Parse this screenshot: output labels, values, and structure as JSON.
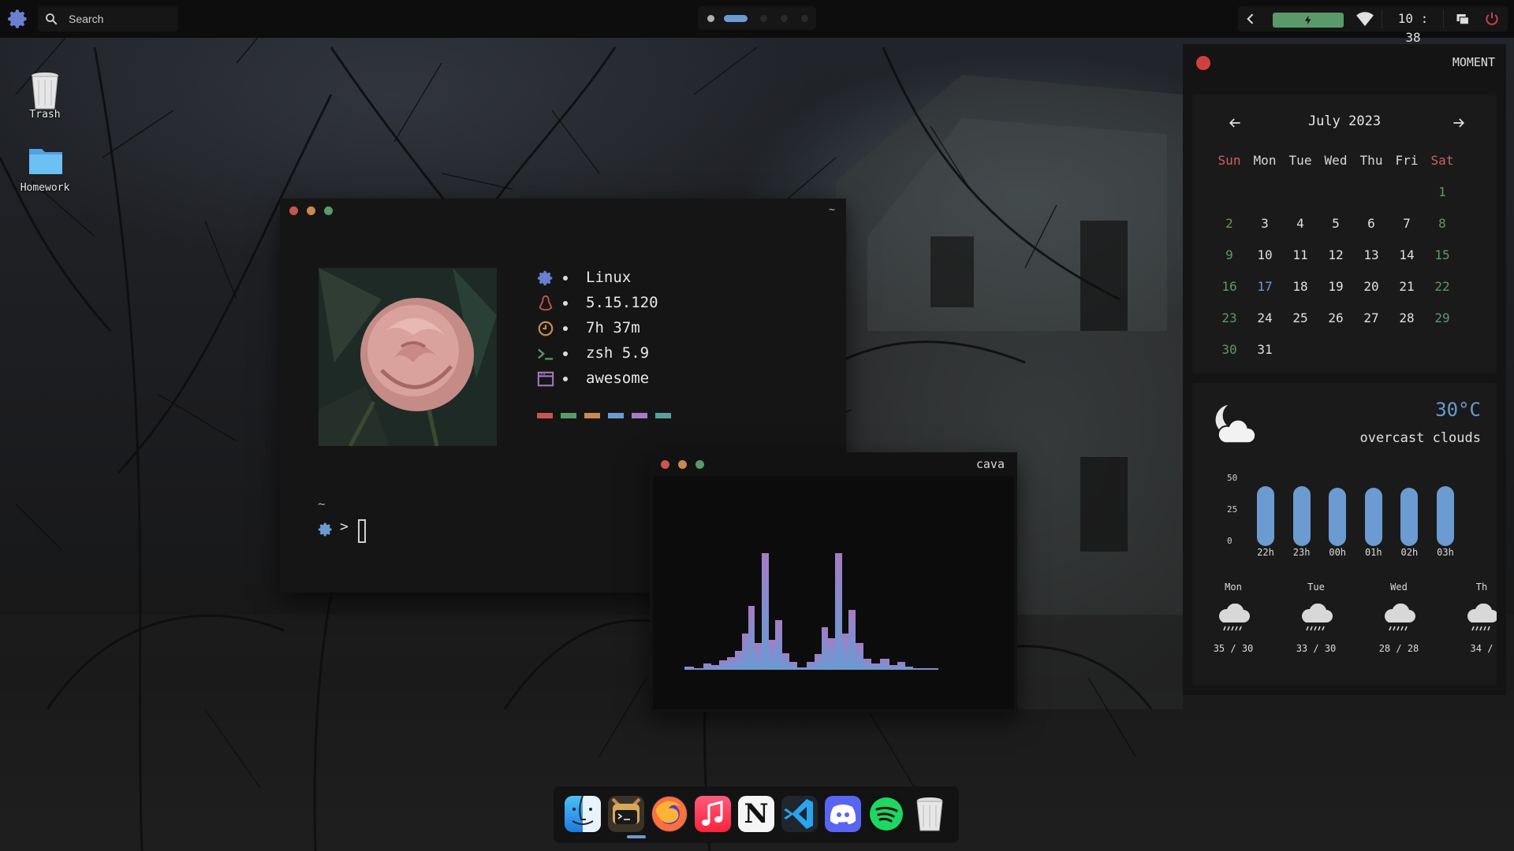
{
  "colors": {
    "accent": "#6b9bd0",
    "green": "#5a9a6a",
    "red": "#d0403f",
    "weekend_head": "#d06060"
  },
  "topbar": {
    "launcher_icon": "gear-icon",
    "search_label": "Search",
    "workspaces": {
      "count": 5,
      "active_index": 1,
      "occupied": [
        0,
        1
      ]
    },
    "clock": "10 : 38"
  },
  "desktop": {
    "icons": [
      {
        "label": "Trash",
        "icon": "trash-icon"
      },
      {
        "label": "Homework",
        "icon": "folder-icon"
      }
    ]
  },
  "terminal": {
    "title": "~",
    "fetch": [
      {
        "icon": "gear-icon",
        "value": "Linux"
      },
      {
        "icon": "tux-icon",
        "value": "5.15.120"
      },
      {
        "icon": "clock-icon",
        "value": "7h 37m"
      },
      {
        "icon": "shell-icon",
        "value": "zsh 5.9"
      },
      {
        "icon": "window-icon",
        "value": "awesome"
      }
    ],
    "palette": [
      "#c9554f",
      "#5a9a6a",
      "#c88a52",
      "#6b9bd0",
      "#a77bc4",
      "#5aa0a0"
    ],
    "prompt_dir": "~",
    "prompt_symbol": ">"
  },
  "cava": {
    "title": "cava"
  },
  "panel": {
    "header": "MOMENT",
    "calendar": {
      "title": "July 2023",
      "weekdays": [
        "Sun",
        "Mon",
        "Tue",
        "Wed",
        "Thu",
        "Fri",
        "Sat"
      ],
      "first_weekday_index": 6,
      "days_in_month": 31,
      "today": 17
    },
    "weather": {
      "temp": "30°C",
      "description": "overcast clouds",
      "axis": [
        "50",
        "25",
        "0"
      ],
      "hourly": [
        {
          "label": "22h",
          "value": 30
        },
        {
          "label": "23h",
          "value": 30
        },
        {
          "label": "00h",
          "value": 29
        },
        {
          "label": "01h",
          "value": 29
        },
        {
          "label": "02h",
          "value": 29
        },
        {
          "label": "03h",
          "value": 30
        }
      ],
      "daily": [
        {
          "day": "Mon",
          "range": "35 / 30",
          "icon": "rain-icon"
        },
        {
          "day": "Tue",
          "range": "33 / 30",
          "icon": "rain-icon"
        },
        {
          "day": "Wed",
          "range": "28 / 28",
          "icon": "rain-icon"
        },
        {
          "day": "Th",
          "range": "34 /",
          "icon": "rain-icon"
        }
      ]
    }
  },
  "dock": {
    "apps": [
      {
        "name": "finder",
        "icon": "finder-icon"
      },
      {
        "name": "terminal",
        "icon": "terminal-icon"
      },
      {
        "name": "firefox",
        "icon": "firefox-icon"
      },
      {
        "name": "music",
        "icon": "music-icon"
      },
      {
        "name": "notion",
        "icon": "notion-icon",
        "text": "N"
      },
      {
        "name": "vscode",
        "icon": "vscode-icon"
      },
      {
        "name": "discord",
        "icon": "discord-icon"
      },
      {
        "name": "spotify",
        "icon": "spotify-icon"
      },
      {
        "name": "trash",
        "icon": "trash-icon"
      }
    ]
  }
}
